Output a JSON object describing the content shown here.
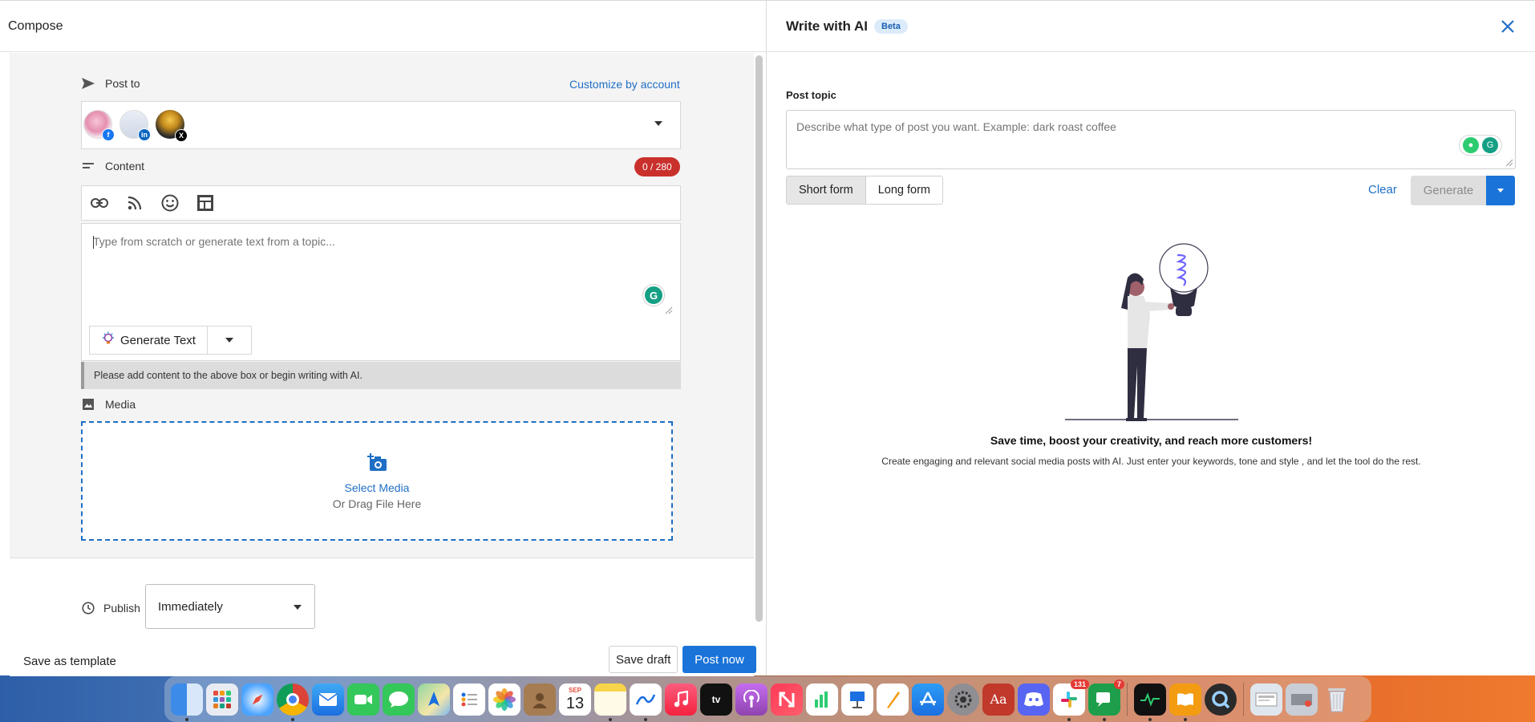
{
  "compose": {
    "title": "Compose",
    "post_to_label": "Post to",
    "customize_label": "Customize by account",
    "accounts": [
      {
        "name": "facebook-account",
        "network": "facebook",
        "badge": "f",
        "badge_color": "#1877f2"
      },
      {
        "name": "linkedin-account",
        "network": "linkedin",
        "badge": "in",
        "badge_color": "#0a66c2"
      },
      {
        "name": "x-account",
        "network": "x",
        "badge": "X",
        "badge_color": "#000000"
      }
    ],
    "content_label": "Content",
    "char_count": "0 / 280",
    "content_placeholder": "Type from scratch or generate text from a topic...",
    "generate_text_label": "Generate Text",
    "warning": "Please add content to the above box or begin writing with AI.",
    "media_label": "Media",
    "select_media_label": "Select Media",
    "drag_file_label": "Or Drag File Here",
    "publish_label": "Publish",
    "publish_value": "Immediately",
    "save_template_label": "Save as template",
    "save_draft_label": "Save draft",
    "post_now_label": "Post now"
  },
  "ai": {
    "title": "Write with AI",
    "badge": "Beta",
    "topic_label": "Post topic",
    "topic_placeholder": "Describe what type of post you want. Example: dark roast coffee",
    "form_options": [
      "Short form",
      "Long form"
    ],
    "active_form": "Short form",
    "clear_label": "Clear",
    "generate_label": "Generate",
    "headline": "Save time, boost your creativity, and reach more customers!",
    "subtext": "Create engaging and relevant social media posts with AI. Just enter your keywords, tone and style , and let the tool do the rest."
  },
  "dock": {
    "calendar_month": "SEP",
    "calendar_day": "13",
    "slack_badge": "131",
    "messages_badge": "7",
    "apps": [
      "finder",
      "launchpad",
      "safari",
      "chrome",
      "mail",
      "facetime",
      "messages",
      "maps",
      "reminders",
      "photos",
      "contacts",
      "calendar",
      "notes",
      "freeform",
      "music",
      "apple-tv",
      "podcasts",
      "news",
      "numbers",
      "keynote",
      "pages",
      "app-store",
      "system-settings",
      "dictionary",
      "discord",
      "slack",
      "messages-chat",
      "activity-monitor",
      "books",
      "quicktime",
      "downloads",
      "recent-stack",
      "trash"
    ]
  },
  "colors": {
    "accent": "#1a73d9",
    "link": "#1f6fc5",
    "danger": "#c9302c",
    "grammarly": "#15a085"
  }
}
